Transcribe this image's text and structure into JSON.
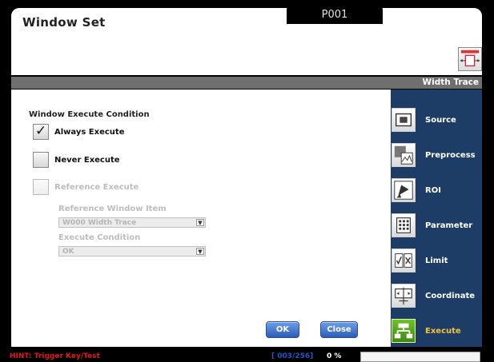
{
  "window": {
    "title": "Window Set",
    "program_tab": "P001",
    "band_label": "Width Trace"
  },
  "execute_panel": {
    "section_title": "Window Execute Condition",
    "options": [
      {
        "label": "Always Execute",
        "checked": true,
        "enabled": true
      },
      {
        "label": "Never Execute",
        "checked": false,
        "enabled": true
      },
      {
        "label": "Reference Execute",
        "checked": false,
        "enabled": false
      }
    ],
    "reference_window_item_label": "Reference Window Item",
    "reference_window_item_value": "W000 Width Trace",
    "execute_condition_label": "Execute Condition",
    "execute_condition_value": "OK"
  },
  "buttons": {
    "ok": "OK",
    "close": "Close"
  },
  "sidebar": {
    "items": [
      {
        "label": "Source",
        "icon": "source-icon"
      },
      {
        "label": "Preprocess",
        "icon": "preprocess-icon"
      },
      {
        "label": "ROI",
        "icon": "roi-icon"
      },
      {
        "label": "Parameter",
        "icon": "parameter-icon"
      },
      {
        "label": "Limit",
        "icon": "limit-icon"
      },
      {
        "label": "Coordinate",
        "icon": "coordinate-icon"
      },
      {
        "label": "Execute",
        "icon": "execute-icon",
        "active": true
      }
    ]
  },
  "status": {
    "hint": "HINT: Trigger Key/Test",
    "counter": "[ 003/256]",
    "percent": "0 %"
  },
  "colors": {
    "sidebar_bg": "#1e3d66",
    "active_label": "#f3c23b",
    "hint_red": "#e0161c",
    "counter_blue": "#1f56c8",
    "button_blue": "#2b5cb8"
  }
}
